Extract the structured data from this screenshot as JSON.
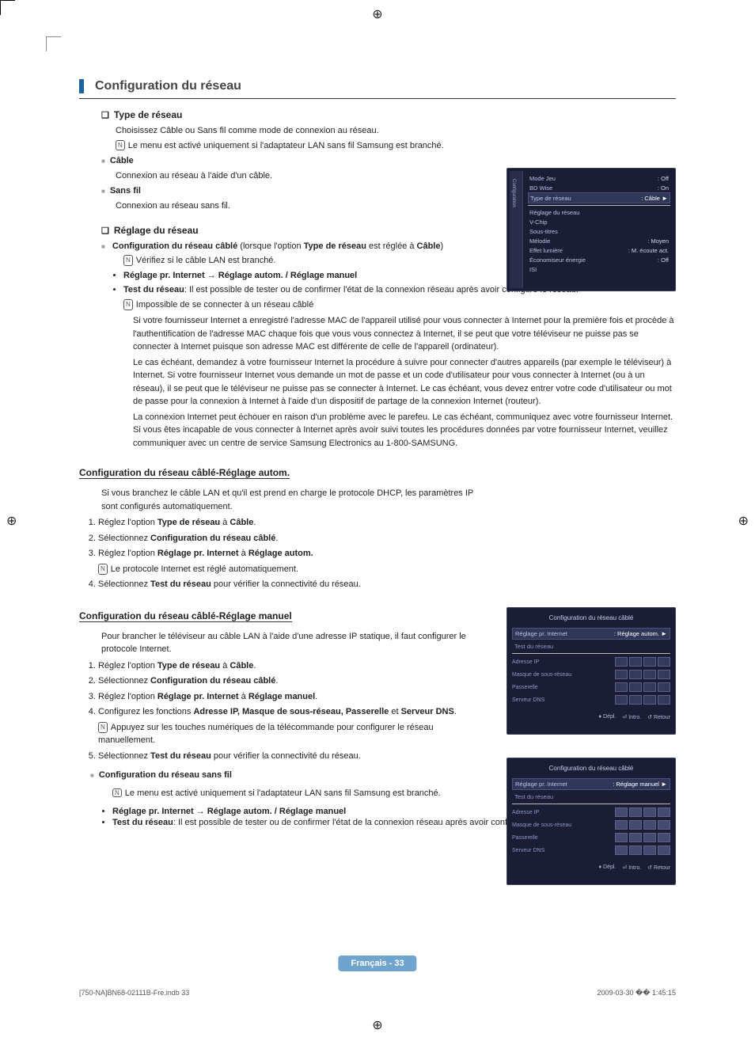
{
  "header": {
    "title": "Configuration du réseau"
  },
  "s1": {
    "title": "Type de réseau",
    "intro": "Choisissez Câble ou Sans fil comme mode de connexion au réseau.",
    "note1": "Le menu est activé uniquement si l'adaptateur LAN sans fil Samsung est branché.",
    "cable_h": "Câble",
    "cable_t": "Connexion au réseau à l'aide d'un câble.",
    "wifi_h": "Sans fil",
    "wifi_t": "Connexion au réseau sans fil."
  },
  "s2": {
    "title": "Réglage du réseau",
    "cfg_h_pre": "Configuration du réseau câblé",
    "cfg_h_mid": " (lorsque l'option ",
    "cfg_h_b1": "Type de réseau",
    "cfg_h_mid2": " est réglée à ",
    "cfg_h_b2": "Câble",
    "cfg_h_end": ")",
    "n1": "Vérifiez si le câble LAN est branché.",
    "b1": "Réglage pr. Internet → Réglage autom. / Réglage manuel",
    "b2_pre": "Test du réseau",
    "b2_txt": ": Il est possible de tester ou de confirmer l'état de la connexion réseau après avoir configuré le réseau.",
    "n2": "Impossible de se connecter à un réseau câblé",
    "p1": "Si votre fournisseur Internet a enregistré l'adresse MAC de l'appareil utilisé pour vous connecter à Internet pour la première fois et procède à l'authentification de l'adresse MAC chaque fois que vous vous connectez à Internet, il se peut que votre téléviseur ne puisse pas se connecter à Internet puisque son adresse MAC est différente de celle de l'appareil (ordinateur).",
    "p2": "Le cas échéant, demandez à votre fournisseur Internet la procédure à suivre pour connecter d'autres appareils (par exemple le téléviseur) à Internet. Si votre fournisseur Internet vous demande un mot de passe et un code d'utilisateur pour vous connecter à Internet (ou à un réseau), il se peut que le téléviseur ne puisse pas se connecter à Internet. Le cas échéant, vous devez entrer votre code d'utilisateur ou mot de passe pour la connexion à Internet à l'aide d'un dispositif de partage de la connexion Internet (routeur).",
    "p3": "La connexion Internet peut échouer en raison d'un problème avec le parefeu. Le cas échéant, communiquez avec votre fournisseur Internet. Si vous êtes incapable de vous connecter à Internet après avoir suivi toutes les procédures données par votre fournisseur Internet, veuillez communiquer avec un centre de service Samsung Electronics au 1-800-SAMSUNG."
  },
  "s3": {
    "title": "Configuration du réseau câblé-Réglage autom.",
    "intro": "Si vous branchez le câble LAN et qu'il est prend en charge le protocole DHCP, les paramètres IP sont configurés automatiquement.",
    "st1_a": "Réglez l'option ",
    "st1_b": "Type de réseau",
    "st1_c": " à ",
    "st1_d": "Câble",
    "st1_e": ".",
    "st2_a": "Sélectionnez ",
    "st2_b": "Configuration du réseau câblé",
    "st2_c": ".",
    "st3_a": "Réglez l'option ",
    "st3_b": "Réglage pr. Internet",
    "st3_c": " à ",
    "st3_d": "Réglage autom.",
    "st3_note": "Le protocole Internet est réglé automatiquement.",
    "st4_a": "Sélectionnez ",
    "st4_b": "Test du réseau",
    "st4_c": " pour vérifier la connectivité du réseau."
  },
  "s4": {
    "title": "Configuration du réseau câblé-Réglage manuel",
    "intro": "Pour brancher le téléviseur au câble LAN à l'aide d'une adresse IP statique, il faut configurer le protocole Internet.",
    "st1_a": "Réglez l'option ",
    "st1_b": "Type de réseau",
    "st1_c": " à ",
    "st1_d": "Câble",
    "st1_e": ".",
    "st2_a": "Sélectionnez ",
    "st2_b": "Configuration du réseau câblé",
    "st2_c": ".",
    "st3_a": "Réglez l'option ",
    "st3_b": "Réglage pr. Internet",
    "st3_c": " à ",
    "st3_d": "Réglage manuel",
    "st3_e": ".",
    "st4_a": "Configurez les fonctions ",
    "st4_b": "Adresse IP, Masque de sous-réseau, Passerelle",
    "st4_c": " et ",
    "st4_d": "Serveur DNS",
    "st4_e": ".",
    "st4_note": "Appuyez sur les touches numériques de la télécommande pour configurer le réseau manuellement.",
    "st5_a": "Sélectionnez ",
    "st5_b": "Test du réseau",
    "st5_c": " pour vérifier la connectivité du réseau.",
    "wifi_h": "Configuration du réseau sans fil",
    "wifi_n1": "Le menu est activé uniquement si l'adaptateur LAN sans fil Samsung est branché.",
    "wifi_b1": "Réglage pr. Internet → Réglage autom. / Réglage manuel",
    "wifi_b2_pre": "Test du réseau",
    "wifi_b2_txt": ": Il est possible de tester ou de confirmer l'état de la connexion réseau après avoir configuré le réseau."
  },
  "osd1": {
    "side": "Configuration",
    "rows": [
      {
        "l": "Mode Jeu",
        "v": ": Off"
      },
      {
        "l": "BD Wise",
        "v": ": On"
      },
      {
        "l": "Type de réseau",
        "v": ": Câble",
        "hl": true,
        "arrow": "►"
      },
      {
        "l": "Réglage du réseau",
        "v": ""
      },
      {
        "l": "V-Chip",
        "v": ""
      },
      {
        "l": "Sous-titres",
        "v": ""
      },
      {
        "l": "Mélodie",
        "v": ": Moyen"
      },
      {
        "l": "Effet lumière",
        "v": ": M. écoute act."
      },
      {
        "l": "Économiseur énergie",
        "v": ": Off"
      },
      {
        "l": "ISI",
        "v": ""
      }
    ]
  },
  "osd2": {
    "title": "Configuration du réseau câblé",
    "sel_l": "Réglage pr. Internet",
    "sel_v": ": Réglage autom.",
    "arrow": "►",
    "r2": "Test du réseau",
    "fields": [
      "Adresse IP",
      "Masque de sous-réseau",
      "Passerelle",
      "Serveur DNS"
    ],
    "foot": {
      "a": "Dépl.",
      "b": "Intro.",
      "c": "Retour"
    }
  },
  "osd3": {
    "title": "Configuration du réseau câblé",
    "sel_l": "Réglage pr. Internet",
    "sel_v": ": Réglage manuel",
    "arrow": "►",
    "r2": "Test du réseau",
    "fields": [
      "Adresse IP",
      "Masque de sous-réseau",
      "Passerelle",
      "Serveur DNS"
    ],
    "foot": {
      "a": "Dépl.",
      "b": "Intro.",
      "c": "Retour"
    }
  },
  "footer": {
    "lang": "Français - 33"
  },
  "meta": {
    "left": "[750-NA]BN68-02111B-Fre.indb   33",
    "right": "2009-03-30   �� 1:45:15"
  }
}
